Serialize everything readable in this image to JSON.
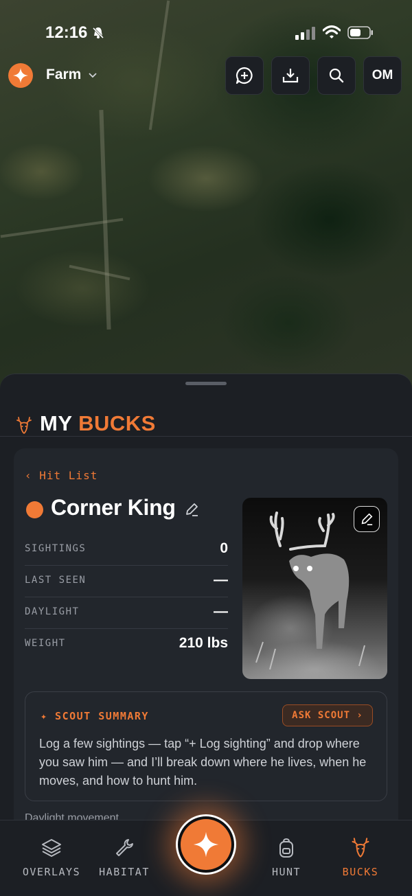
{
  "status_bar": {
    "time": "12:16"
  },
  "header": {
    "farm_name": "Farm",
    "profile_initials": "OM"
  },
  "sheet": {
    "title_a": "MY",
    "title_b": "BUCKS",
    "back_label": "‹ Hit List",
    "buck_name": "Corner King",
    "stats": [
      {
        "label": "SIGHTINGS",
        "value": "0"
      },
      {
        "label": "LAST SEEN",
        "value": "—"
      },
      {
        "label": "DAYLIGHT",
        "value": "—"
      },
      {
        "label": "WEIGHT",
        "value": "210 lbs"
      }
    ],
    "scout": {
      "title": "✦ SCOUT SUMMARY",
      "ask_label": "ASK SCOUT ›",
      "body": "Log a few sightings — tap “+ Log sighting” and drop where you saw him — and I’ll break down where he lives, when he moves, and how to hunt him."
    },
    "next_section": "Daylight movement"
  },
  "nav": {
    "items": [
      {
        "label": "OVERLAYS",
        "icon": "layers-icon"
      },
      {
        "label": "HABITAT",
        "icon": "wrench-icon"
      },
      {
        "label": "HUNT",
        "icon": "backpack-icon"
      },
      {
        "label": "BUCKS",
        "icon": "deer-icon"
      }
    ]
  },
  "colors": {
    "accent": "#f07a36",
    "surface": "#1c1f24",
    "card": "#22262c"
  }
}
